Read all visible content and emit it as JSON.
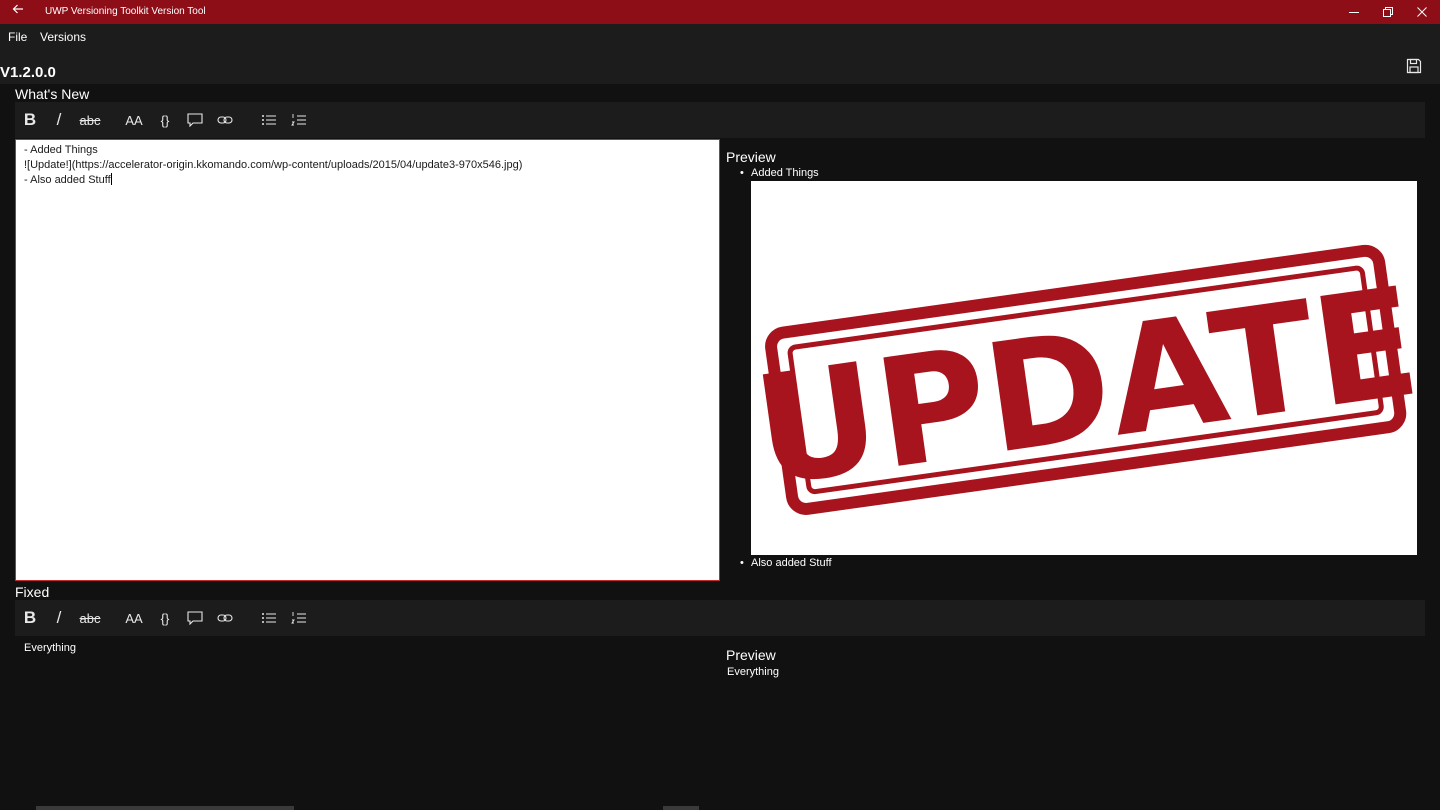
{
  "window": {
    "title": "UWP Versioning Toolkit Version Tool",
    "accent": "#8e0e18"
  },
  "menu": {
    "file": "File",
    "versions": "Versions"
  },
  "version": {
    "label": "V1.2.0.0"
  },
  "toolbar": {
    "bold": "B",
    "italic": "/",
    "strike": "abc",
    "font_size": "AA",
    "code": "{}",
    "icons": [
      "bold-icon",
      "italic-icon",
      "strikethrough-icon",
      "font-size-icon",
      "code-icon",
      "quote-icon",
      "link-icon",
      "bulleted-list-icon",
      "numbered-list-icon"
    ]
  },
  "whats_new": {
    "label": "What's New",
    "editor_lines": [
      "- Added Things",
      "![Update!](https://accelerator-origin.kkomando.com/wp-content/uploads/2015/04/update3-970x546.jpg)",
      "- Also added Stuff"
    ],
    "preview_label": "Preview",
    "preview_items": [
      "Added Things",
      "Also added Stuff"
    ],
    "preview_image_text": "UPDATE",
    "stamp_color": "#a8141e"
  },
  "fixed": {
    "label": "Fixed",
    "editor_text": "Everything",
    "preview_label": "Preview",
    "preview_text": "Everything"
  }
}
